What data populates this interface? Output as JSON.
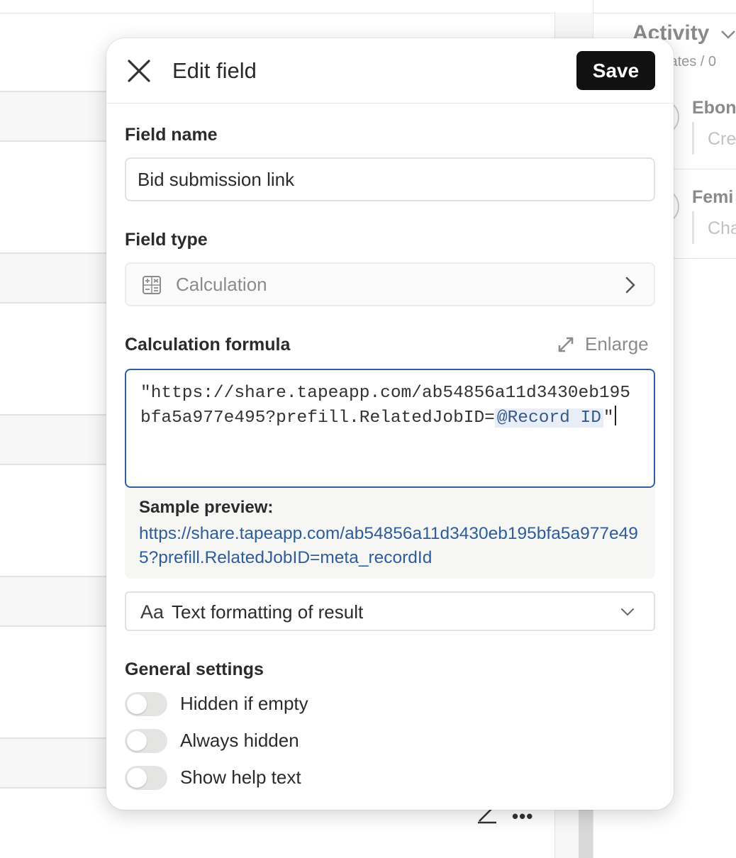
{
  "background": {
    "activity_title": "Activity",
    "activity_updates": "lates / 0",
    "entries": [
      {
        "name": "Ebon",
        "sub": "Cre"
      },
      {
        "name": "Femi",
        "sub": "Cha"
      }
    ],
    "more_glyph": "•••"
  },
  "modal": {
    "title": "Edit field",
    "save_label": "Save",
    "field_name": {
      "label": "Field name",
      "value": "Bid submission link"
    },
    "field_type": {
      "label": "Field type",
      "value": "Calculation",
      "icon": "calculator-icon"
    },
    "formula": {
      "label": "Calculation formula",
      "enlarge_label": "Enlarge",
      "text_before": "\"https://share.tapeapp.com/ab54856a11d3430eb195bfa5a977e495?prefill.RelatedJobID=",
      "token": "@Record ID",
      "text_after": "\""
    },
    "preview": {
      "label": "Sample preview:",
      "link": "https://share.tapeapp.com/ab54856a11d3430eb195bfa5a977e495?prefill.RelatedJobID=meta_recordId"
    },
    "formatting": {
      "icon_text": "Aa",
      "label": "Text formatting of result"
    },
    "general_settings": {
      "label": "General settings",
      "toggles": [
        {
          "label": "Hidden if empty",
          "on": false
        },
        {
          "label": "Always hidden",
          "on": false
        },
        {
          "label": "Show help text",
          "on": false
        }
      ]
    }
  },
  "colors": {
    "accent_border": "#2f5fa0",
    "link": "#2d5d9c",
    "save_bg": "#111111"
  }
}
